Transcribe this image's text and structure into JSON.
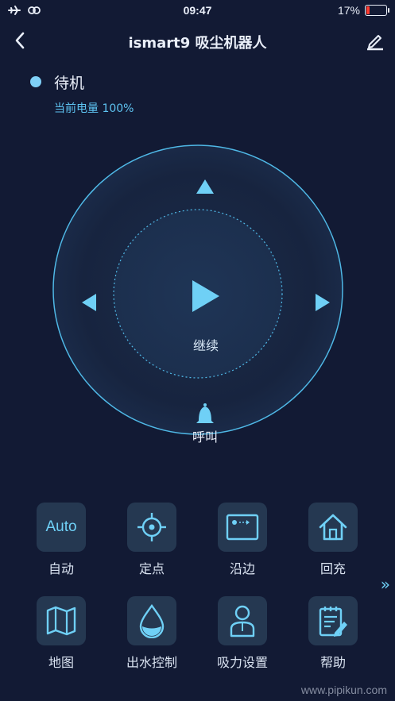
{
  "status_bar": {
    "time": "09:47",
    "battery_percent": "17%",
    "battery_level": 0.17
  },
  "nav": {
    "title": "ismart9 吸尘机器人"
  },
  "device": {
    "state": "待机",
    "battery_text": "当前电量 100%"
  },
  "control": {
    "center_label": "继续",
    "call_label": "呼叫"
  },
  "functions": [
    {
      "label": "自动",
      "icon": "auto-text-icon",
      "text": "Auto"
    },
    {
      "label": "定点",
      "icon": "target-icon"
    },
    {
      "label": "沿边",
      "icon": "edge-icon"
    },
    {
      "label": "回充",
      "icon": "home-icon"
    },
    {
      "label": "地图",
      "icon": "map-icon"
    },
    {
      "label": "出水控制",
      "icon": "water-drop-icon"
    },
    {
      "label": "吸力设置",
      "icon": "suction-user-icon"
    },
    {
      "label": "帮助",
      "icon": "clipboard-edit-icon"
    }
  ],
  "watermark": "www.pipikun.com",
  "colors": {
    "background": "#121a34",
    "accent": "#5ec4f2",
    "tile": "#253851"
  }
}
